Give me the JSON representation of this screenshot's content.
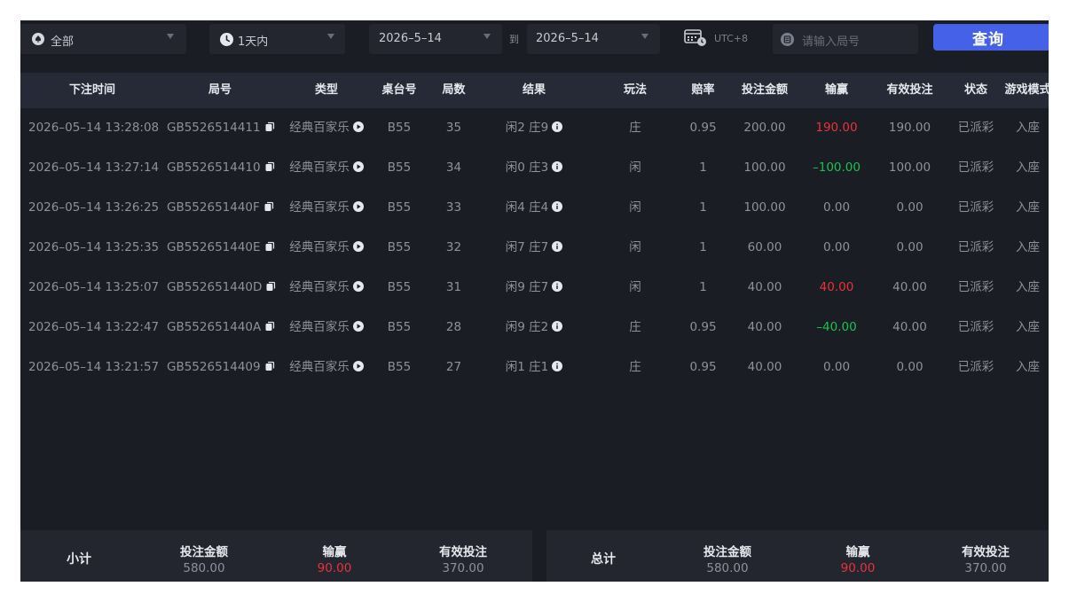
{
  "filters": {
    "category": "全部",
    "time_range": "1天内",
    "date_from": "2026–5–14",
    "to_label": "到",
    "date_to": "2026–5–14",
    "timezone": "UTC+8",
    "round_placeholder": "请输入局号",
    "search_label": "查询"
  },
  "table": {
    "headers": [
      "下注时间",
      "局号",
      "类型",
      "桌台号",
      "局数",
      "结果",
      "玩法",
      "赔率",
      "投注金额",
      "输赢",
      "有效投注",
      "状态",
      "游戏模式"
    ],
    "rows": [
      {
        "time": "2026–05–14 13:28:08",
        "round": "GB5526514411",
        "type": "经典百家乐",
        "table": "B55",
        "num": "35",
        "result": "闲2 庄9",
        "bet": "庄",
        "odds": "0.95",
        "amount": "200.00",
        "winloss": "190.00",
        "wl": "win",
        "valid": "190.00",
        "status": "已派彩",
        "mode": "入座"
      },
      {
        "time": "2026–05–14 13:27:14",
        "round": "GB5526514410",
        "type": "经典百家乐",
        "table": "B55",
        "num": "34",
        "result": "闲0 庄3",
        "bet": "闲",
        "odds": "1",
        "amount": "100.00",
        "winloss": "–100.00",
        "wl": "lose",
        "valid": "100.00",
        "status": "已派彩",
        "mode": "入座"
      },
      {
        "time": "2026–05–14 13:26:25",
        "round": "GB552651440F",
        "type": "经典百家乐",
        "table": "B55",
        "num": "33",
        "result": "闲4 庄4",
        "bet": "闲",
        "odds": "1",
        "amount": "100.00",
        "winloss": "0.00",
        "wl": "even",
        "valid": "0.00",
        "status": "已派彩",
        "mode": "入座"
      },
      {
        "time": "2026–05–14 13:25:35",
        "round": "GB552651440E",
        "type": "经典百家乐",
        "table": "B55",
        "num": "32",
        "result": "闲7 庄7",
        "bet": "闲",
        "odds": "1",
        "amount": "60.00",
        "winloss": "0.00",
        "wl": "even",
        "valid": "0.00",
        "status": "已派彩",
        "mode": "入座"
      },
      {
        "time": "2026–05–14 13:25:07",
        "round": "GB552651440D",
        "type": "经典百家乐",
        "table": "B55",
        "num": "31",
        "result": "闲9 庄7",
        "bet": "闲",
        "odds": "1",
        "amount": "40.00",
        "winloss": "40.00",
        "wl": "win",
        "valid": "40.00",
        "status": "已派彩",
        "mode": "入座"
      },
      {
        "time": "2026–05–14 13:22:47",
        "round": "GB552651440A",
        "type": "经典百家乐",
        "table": "B55",
        "num": "28",
        "result": "闲9 庄2",
        "bet": "庄",
        "odds": "0.95",
        "amount": "40.00",
        "winloss": "–40.00",
        "wl": "lose",
        "valid": "40.00",
        "status": "已派彩",
        "mode": "入座"
      },
      {
        "time": "2026–05–14 13:21:57",
        "round": "GB5526514409",
        "type": "经典百家乐",
        "table": "B55",
        "num": "27",
        "result": "闲1 庄1",
        "bet": "庄",
        "odds": "0.95",
        "amount": "40.00",
        "winloss": "0.00",
        "wl": "even",
        "valid": "0.00",
        "status": "已派彩",
        "mode": "入座"
      }
    ]
  },
  "subtotal": {
    "label": "小计",
    "amount_label": "投注金额",
    "amount": "580.00",
    "winloss_label": "输赢",
    "winloss": "90.00",
    "valid_label": "有效投注",
    "valid": "370.00"
  },
  "total": {
    "label": "总计",
    "amount_label": "投注金额",
    "amount": "580.00",
    "winloss_label": "输赢",
    "winloss": "90.00",
    "valid_label": "有效投注",
    "valid": "370.00"
  },
  "colors": {
    "accent": "#4461e8",
    "win": "#e8333b",
    "lose": "#17c34e",
    "panel": "#1b1d24"
  },
  "icons": {
    "category": "spade-icon",
    "time": "clock-icon",
    "timezone": "calendar-clock-icon",
    "round": "round-icon",
    "copy": "copy-icon",
    "play": "play-icon",
    "info": "info-icon"
  }
}
